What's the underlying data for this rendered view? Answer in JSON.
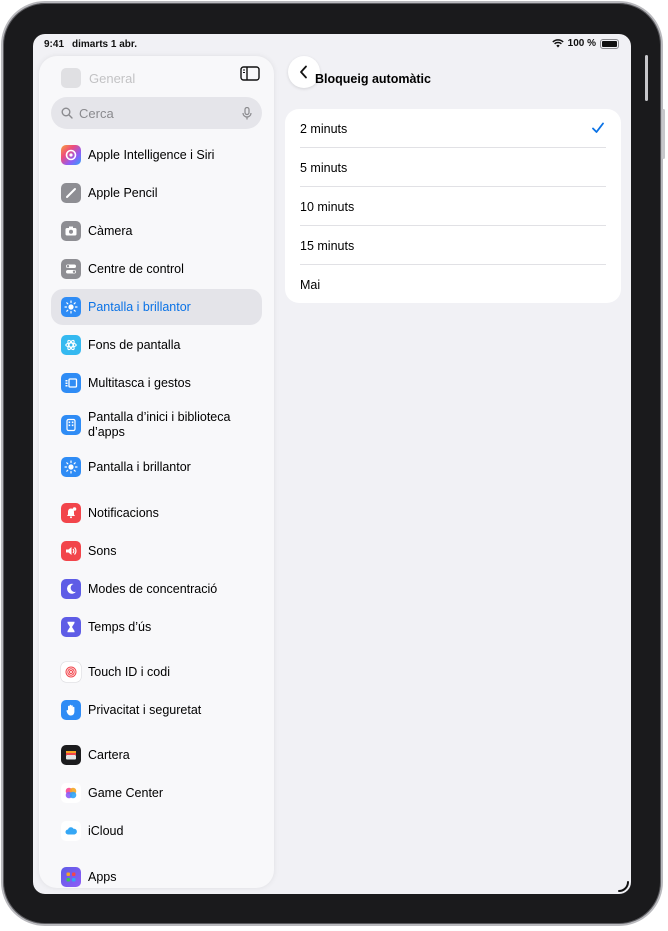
{
  "status_bar": {
    "time": "9:41",
    "date": "dimarts 1 abr.",
    "battery": "100 %"
  },
  "sidebar": {
    "faded_header": "General",
    "search_placeholder": "Cerca",
    "items": [
      {
        "label": "Apple Intelligence i Siri",
        "icon": "apple-intelligence-icon",
        "color": "#8e5cf7"
      },
      {
        "label": "Apple Pencil",
        "icon": "pencil-icon",
        "color": "#8e8e93"
      },
      {
        "label": "Càmera",
        "icon": "camera-icon",
        "color": "#8e8e93"
      },
      {
        "label": "Centre de control",
        "icon": "control-center-icon",
        "color": "#8e8e93"
      },
      {
        "label": "Pantalla i brillantor",
        "icon": "brightness-icon",
        "color": "#2f8cf5",
        "selected": true
      },
      {
        "label": "Fons de pantalla",
        "icon": "wallpaper-icon",
        "color": "#35b9f0"
      },
      {
        "label": "Multitasca i gestos",
        "icon": "multitasking-icon",
        "color": "#2f8cf5"
      },
      {
        "label": "Pantalla d’inici i biblioteca d’apps",
        "icon": "home-screen-icon",
        "color": "#2f8cf5"
      },
      {
        "label": "Pantalla i brillantor",
        "icon": "brightness-icon",
        "color": "#2f8cf5"
      },
      {
        "label": "Notificacions",
        "icon": "notifications-icon",
        "color": "#f2454b"
      },
      {
        "label": "Sons",
        "icon": "sounds-icon",
        "color": "#f2454b"
      },
      {
        "label": "Modes de concentració",
        "icon": "focus-moon-icon",
        "color": "#5e5ce6"
      },
      {
        "label": "Temps d’ús",
        "icon": "hourglass-icon",
        "color": "#5e5ce6"
      },
      {
        "label": "Touch ID i codi",
        "icon": "fingerprint-icon",
        "color": "#ffffff"
      },
      {
        "label": "Privacitat i seguretat",
        "icon": "hand-icon",
        "color": "#2f8cf5"
      },
      {
        "label": "Cartera",
        "icon": "wallet-icon",
        "color": "#1c1c1e"
      },
      {
        "label": "Game Center",
        "icon": "game-center-icon",
        "color": "#ffffff"
      },
      {
        "label": "iCloud",
        "icon": "icloud-icon",
        "color": "#ffffff"
      },
      {
        "label": "Apps",
        "icon": "apps-icon",
        "color": "#5e5ce6"
      }
    ]
  },
  "detail": {
    "title": "Bloqueig automàtic",
    "options": [
      {
        "label": "2 minuts",
        "checked": true
      },
      {
        "label": "5 minuts",
        "checked": false
      },
      {
        "label": "10 minuts",
        "checked": false
      },
      {
        "label": "15 minuts",
        "checked": false
      },
      {
        "label": "Mai",
        "checked": false
      }
    ]
  },
  "accent_color": "#0a72e6"
}
